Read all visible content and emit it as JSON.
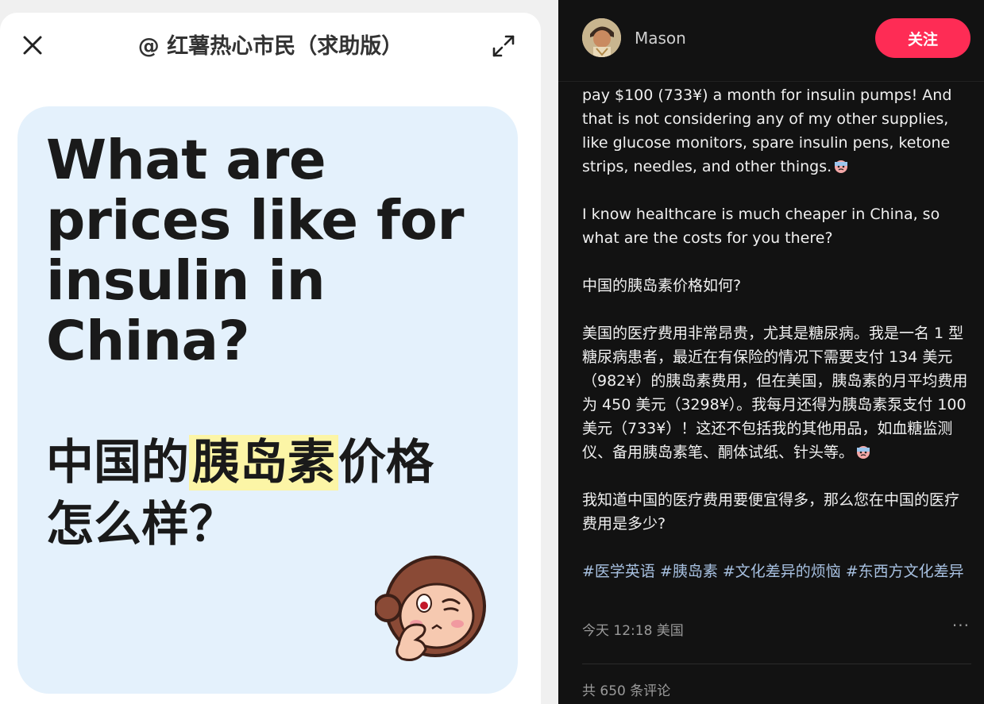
{
  "left": {
    "title": "@ 红薯热心市民（求助版）",
    "card": {
      "english_heading": "What are prices like for insulin in China?",
      "zh_line1_pre": "中国的",
      "zh_line1_highlight": "胰岛素",
      "zh_line1_post": "价格",
      "zh_line2": "怎么样？"
    }
  },
  "right": {
    "author": "Mason",
    "follow_label": "关注",
    "paragraphs": [
      "pay $100 (733¥) a month for insulin pumps! And that is not considering any of my other supplies, like glucose monitors, spare insulin pens, ketone strips, needles, and other things.",
      "I know healthcare is much cheaper in China, so what are the costs for you there?",
      "中国的胰岛素价格如何?",
      "美国的医疗费用非常昂贵，尤其是糖尿病。我是一名 1 型糖尿病患者，最近在有保险的情况下需要支付 134 美元（982¥）的胰岛素费用，但在美国，胰岛素的月平均费用为 450 美元（3298¥）。我每月还得为胰岛素泵支付 100 美元（733¥）！这还不包括我的其他用品，如血糖监测仪、备用胰岛素笔、酮体试纸、针头等。",
      "我知道中国的医疗费用要便宜得多，那么您在中国的医疗费用是多少?"
    ],
    "tags": [
      "#医学英语",
      "#胰岛素",
      "#文化差异的烦恼",
      "#东西方文化差异"
    ],
    "meta": "今天 12:18 美国",
    "more": "···",
    "comment_count": "共 650 条评论"
  },
  "colors": {
    "follow": "#fe2c55",
    "card_bg": "#e4f1fc",
    "highlight": "#fcf5a6",
    "tag": "#a7c0e0"
  }
}
